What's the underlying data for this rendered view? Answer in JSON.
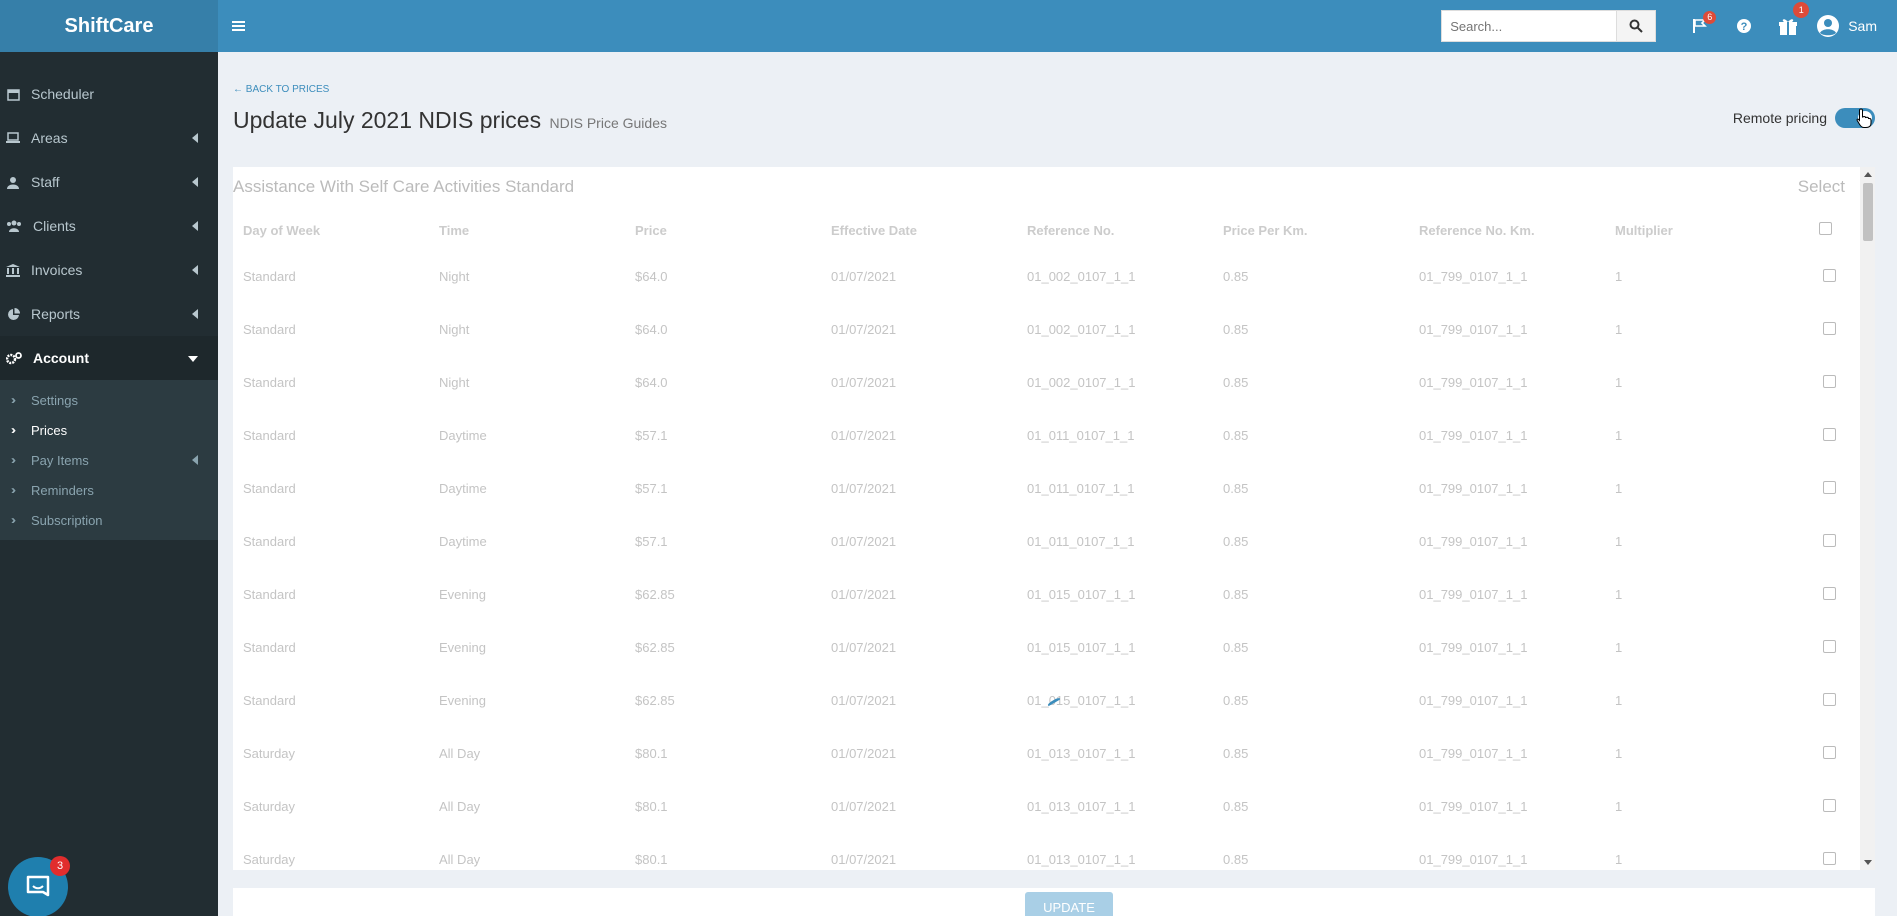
{
  "app": {
    "brand": "ShiftCare"
  },
  "header": {
    "search": {
      "placeholder": "Search...",
      "value": ""
    },
    "flags_badge": "6",
    "gift_badge": "1",
    "user_name": "Sam"
  },
  "sidebar": {
    "items": [
      {
        "label": "Scheduler",
        "icon": "calendar-icon"
      },
      {
        "label": "Areas",
        "icon": "laptop-icon"
      },
      {
        "label": "Staff",
        "icon": "user-icon"
      },
      {
        "label": "Clients",
        "icon": "users-icon"
      },
      {
        "label": "Invoices",
        "icon": "bank-icon"
      },
      {
        "label": "Reports",
        "icon": "pie-chart-icon"
      },
      {
        "label": "Account",
        "icon": "cogs-icon"
      }
    ],
    "account_sub": [
      {
        "label": "Settings"
      },
      {
        "label": "Prices"
      },
      {
        "label": "Pay Items"
      },
      {
        "label": "Reminders"
      },
      {
        "label": "Subscription"
      }
    ]
  },
  "page": {
    "back_label": "BACK TO PRICES",
    "title": "Update July 2021 NDIS prices",
    "subtitle": "NDIS Price Guides",
    "remote_pricing_label": "Remote pricing",
    "remote_pricing_on": true
  },
  "panel": {
    "title": "Assistance With Self Care Activities Standard",
    "select_label": "Select",
    "columns": [
      "Day of Week",
      "Time",
      "Price",
      "Effective Date",
      "Reference No.",
      "Price Per Km.",
      "Reference No. Km.",
      "Multiplier"
    ],
    "rows": [
      [
        "Standard",
        "Night",
        "$64.0",
        "01/07/2021",
        "01_002_0107_1_1",
        "0.85",
        "01_799_0107_1_1",
        "1"
      ],
      [
        "Standard",
        "Night",
        "$64.0",
        "01/07/2021",
        "01_002_0107_1_1",
        "0.85",
        "01_799_0107_1_1",
        "1"
      ],
      [
        "Standard",
        "Night",
        "$64.0",
        "01/07/2021",
        "01_002_0107_1_1",
        "0.85",
        "01_799_0107_1_1",
        "1"
      ],
      [
        "Standard",
        "Daytime",
        "$57.1",
        "01/07/2021",
        "01_011_0107_1_1",
        "0.85",
        "01_799_0107_1_1",
        "1"
      ],
      [
        "Standard",
        "Daytime",
        "$57.1",
        "01/07/2021",
        "01_011_0107_1_1",
        "0.85",
        "01_799_0107_1_1",
        "1"
      ],
      [
        "Standard",
        "Daytime",
        "$57.1",
        "01/07/2021",
        "01_011_0107_1_1",
        "0.85",
        "01_799_0107_1_1",
        "1"
      ],
      [
        "Standard",
        "Evening",
        "$62.85",
        "01/07/2021",
        "01_015_0107_1_1",
        "0.85",
        "01_799_0107_1_1",
        "1"
      ],
      [
        "Standard",
        "Evening",
        "$62.85",
        "01/07/2021",
        "01_015_0107_1_1",
        "0.85",
        "01_799_0107_1_1",
        "1"
      ],
      [
        "Standard",
        "Evening",
        "$62.85",
        "01/07/2021",
        "01_015_0107_1_1",
        "0.85",
        "01_799_0107_1_1",
        "1"
      ],
      [
        "Saturday",
        "All Day",
        "$80.1",
        "01/07/2021",
        "01_013_0107_1_1",
        "0.85",
        "01_799_0107_1_1",
        "1"
      ],
      [
        "Saturday",
        "All Day",
        "$80.1",
        "01/07/2021",
        "01_013_0107_1_1",
        "0.85",
        "01_799_0107_1_1",
        "1"
      ],
      [
        "Saturday",
        "All Day",
        "$80.1",
        "01/07/2021",
        "01_013_0107_1_1",
        "0.85",
        "01_799_0107_1_1",
        "1"
      ]
    ]
  },
  "footer": {
    "update_label": "UPDATE"
  },
  "chat": {
    "badge": "3"
  },
  "colors": {
    "header": "#3c8dbc",
    "brand": "#367fa9",
    "sidebar": "#222d32",
    "badge": "#dd4b39"
  }
}
